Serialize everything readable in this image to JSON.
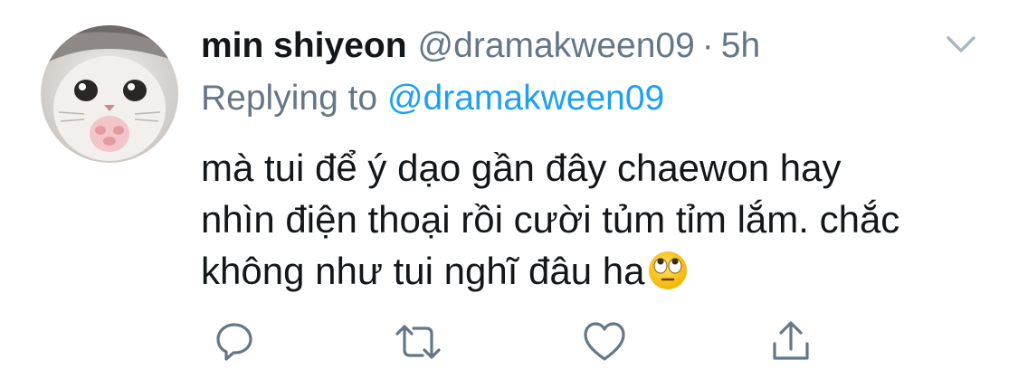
{
  "tweet": {
    "display_name": "min shiyeon",
    "handle": "@dramakween09",
    "separator": "·",
    "time": "5h",
    "replying_prefix": "Replying to",
    "replying_to": "@dramakween09",
    "text_lines": [
      "mà tui để ý dạo gần đây chaewon hay",
      "nhìn điện thoại rồi cười tủm tỉm lắm. chắc",
      "không như tui nghĩ đâu ha"
    ],
    "trailing_emoji": "face-with-rolling-eyes"
  },
  "icons": {
    "avatar": "cat-avatar",
    "menu": "chevron-down-icon",
    "reply": "reply-icon",
    "retweet": "retweet-icon",
    "like": "heart-icon",
    "share": "share-icon"
  },
  "colors": {
    "text": "#14171a",
    "secondary": "#657786",
    "link": "#1da1f2",
    "icon": "#657786",
    "caret": "#aab8c2"
  }
}
